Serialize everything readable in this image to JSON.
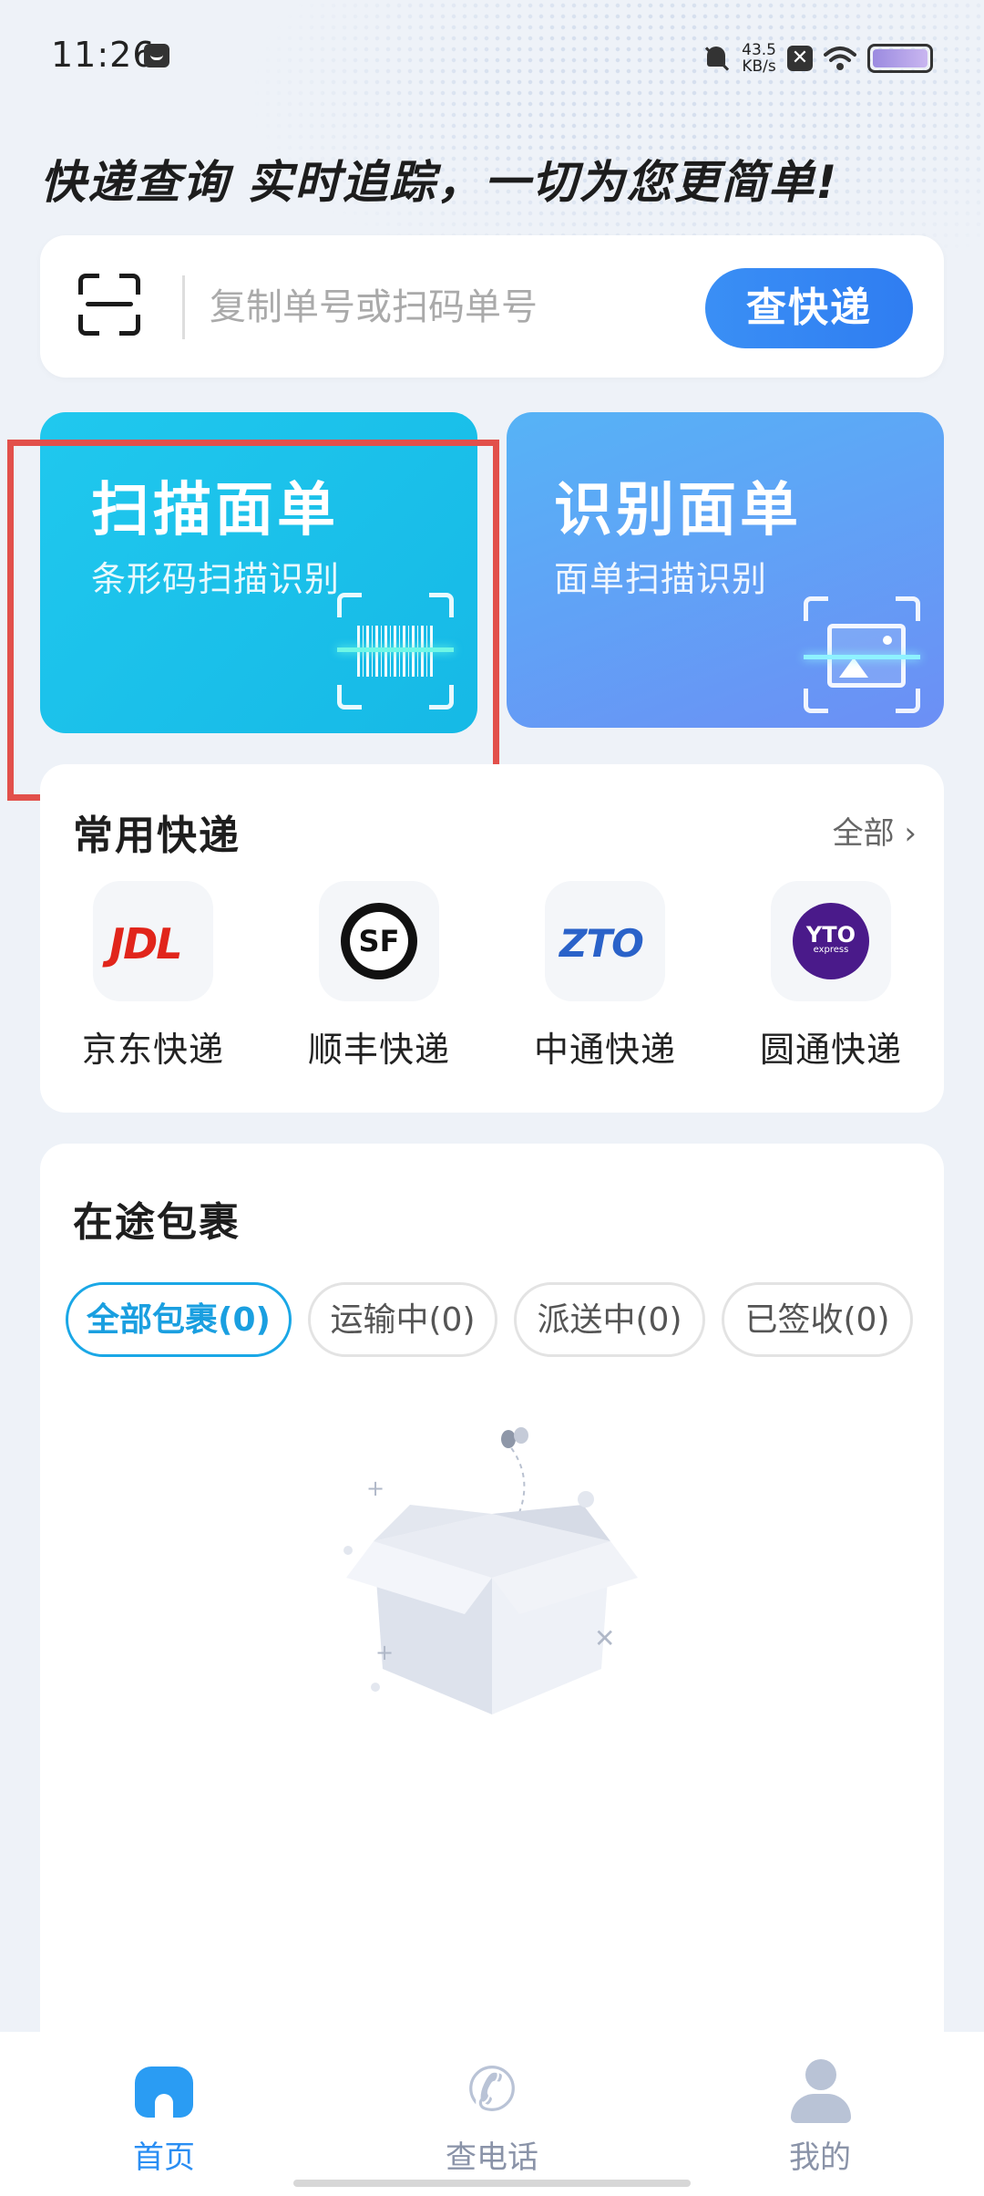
{
  "status_bar": {
    "time": "11:26",
    "net_speed_value": "43.5",
    "net_speed_unit": "KB/s",
    "icons": [
      "message-icon",
      "bell-muted-icon",
      "close-box-icon",
      "wifi-icon",
      "battery-icon"
    ]
  },
  "header": {
    "slogan": "快递查询 实时追踪，一切为您更简单!"
  },
  "search": {
    "placeholder": "复制单号或扫码单号",
    "value": "",
    "button_label": "查快递"
  },
  "features": [
    {
      "title": "扫描面单",
      "subtitle": "条形码扫描识别",
      "icon": "barcode-scan-icon"
    },
    {
      "title": "识别面单",
      "subtitle": "面单扫描识别",
      "icon": "image-scan-icon"
    }
  ],
  "couriers": {
    "title": "常用快递",
    "all_label": "全部",
    "items": [
      {
        "name": "京东快递",
        "logo_text": "JDL",
        "brand_color": "#e1251b"
      },
      {
        "name": "顺丰快递",
        "logo_text": "SF",
        "brand_color": "#111111"
      },
      {
        "name": "中通快递",
        "logo_text": "ZTO",
        "brand_color": "#2a62c9"
      },
      {
        "name": "圆通快递",
        "logo_text": "YTO",
        "logo_subtext": "express",
        "brand_color": "#4a1a8a"
      }
    ]
  },
  "in_transit": {
    "title": "在途包裹",
    "filters": [
      {
        "label": "全部包裹(0)",
        "active": true
      },
      {
        "label": "运输中(0)",
        "active": false
      },
      {
        "label": "派送中(0)",
        "active": false
      },
      {
        "label": "已签收(0)",
        "active": false
      }
    ]
  },
  "bottom_nav": {
    "items": [
      {
        "label": "首页",
        "icon": "home-icon",
        "active": true
      },
      {
        "label": "查电话",
        "icon": "phone-icon",
        "active": false
      },
      {
        "label": "我的",
        "icon": "user-icon",
        "active": false
      }
    ]
  },
  "colors": {
    "accent": "#2f7df1",
    "scan_card": "#1cc2ec",
    "recognize_card": "#6a9bf5",
    "highlight": "#e2504b",
    "active_chip": "#1aa7e6"
  }
}
